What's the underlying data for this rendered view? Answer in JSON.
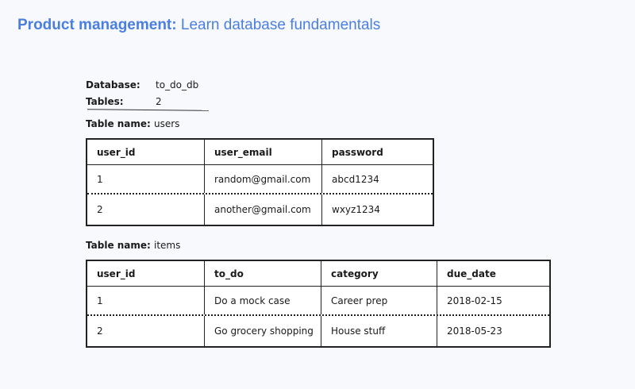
{
  "header": {
    "category": "Product management:",
    "title": "Learn database fundamentals"
  },
  "database_info": {
    "database_label": "Database:",
    "database_value": "to_do_db",
    "tables_label": "Tables:",
    "tables_value": "2"
  },
  "tables": [
    {
      "name_label": "Table name:",
      "name": "users",
      "columns": [
        "user_id",
        "user_email",
        "password"
      ],
      "rows": [
        [
          "1",
          "random@gmail.com",
          "abcd1234"
        ],
        [
          "2",
          "another@gmail.com",
          "wxyz1234"
        ]
      ]
    },
    {
      "name_label": "Table name:",
      "name": "items",
      "columns": [
        "user_id",
        "to_do",
        "category",
        "due_date"
      ],
      "rows": [
        [
          "1",
          "Do a mock case",
          "Career prep",
          "2018-02-15"
        ],
        [
          "2",
          "Go grocery shopping",
          "House stuff",
          "2018-05-23"
        ]
      ]
    }
  ],
  "colors": {
    "header_accent": "#4a7fe0",
    "background": "#f8f9fc",
    "ink": "#222222"
  }
}
